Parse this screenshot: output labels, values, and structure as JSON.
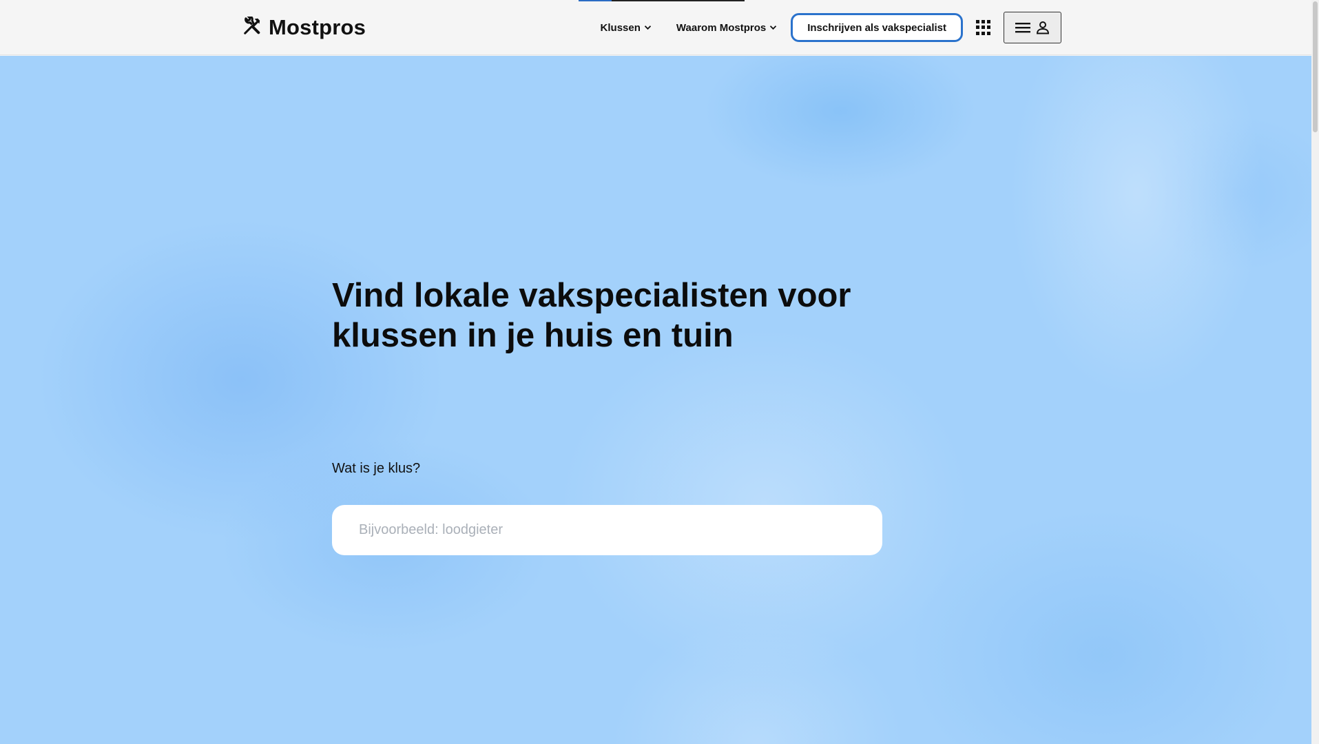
{
  "brand": {
    "name": "Mostpros",
    "icon": "tools-icon"
  },
  "nav": {
    "items": [
      {
        "label": "Klussen",
        "icon": "chevron-down-icon"
      },
      {
        "label": "Waarom Mostpros",
        "icon": "chevron-down-icon"
      }
    ],
    "signup_label": "Inschrijven als vakspecialist",
    "apps_icon": "grid-icon",
    "menu_icons": [
      "hamburger-icon",
      "user-icon"
    ]
  },
  "hero": {
    "title": "Vind lokale vakspecialisten voor klussen in je huis en tuin",
    "question": "Wat is je klus?",
    "search_placeholder": "Bijvoorbeeld: loodgieter",
    "search_value": ""
  },
  "colors": {
    "accent": "#2a72cc",
    "hero_background": "#a3d1fb",
    "header_background": "#f5f5f5"
  }
}
